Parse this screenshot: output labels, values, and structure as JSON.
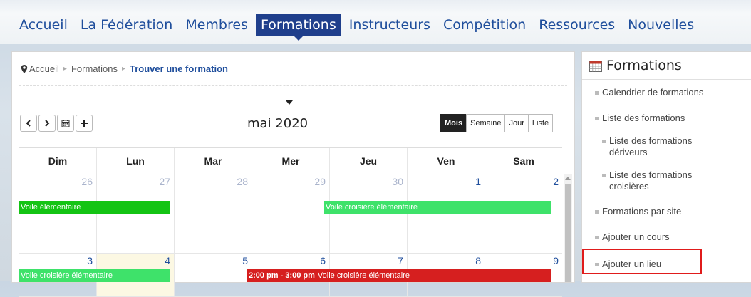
{
  "nav": {
    "items": [
      "Accueil",
      "La Fédération",
      "Membres",
      "Formations",
      "Instructeurs",
      "Compétition",
      "Ressources",
      "Nouvelles"
    ],
    "active_index": 3
  },
  "breadcrumb": {
    "home": "Accueil",
    "section": "Formations",
    "current": "Trouver une formation"
  },
  "calendar": {
    "title": "mai 2020",
    "views": [
      "Mois",
      "Semaine",
      "Jour",
      "Liste"
    ],
    "active_view": "Mois",
    "day_headers": [
      "Dim",
      "Lun",
      "Mar",
      "Mer",
      "Jeu",
      "Ven",
      "Sam"
    ],
    "week1_days": [
      "26",
      "27",
      "28",
      "29",
      "30",
      "1",
      "2"
    ],
    "week2_days": [
      "3",
      "4",
      "5",
      "6",
      "7",
      "8",
      "9"
    ],
    "events": {
      "e1": "Voile élémentaire",
      "e2": "Voile croisière élémentaire",
      "e3": "Voile croisière élémentaire",
      "e4_time": "2:00 pm - 3:00 pm",
      "e4": "Voile croisière élémentaire"
    },
    "colors": {
      "green": "#14c414",
      "lightgreen": "#3ee26a",
      "red": "#d61f1f"
    }
  },
  "sidebar": {
    "title": "Formations",
    "items": {
      "calendrier": "Calendrier de formations",
      "liste": "Liste des formations",
      "deriveurs": "Liste des formations dériveurs",
      "croisieres": "Liste des formations croisières",
      "par_site": "Formations par site",
      "ajouter_cours": "Ajouter un cours",
      "ajouter_lieu": "Ajouter un lieu"
    }
  }
}
